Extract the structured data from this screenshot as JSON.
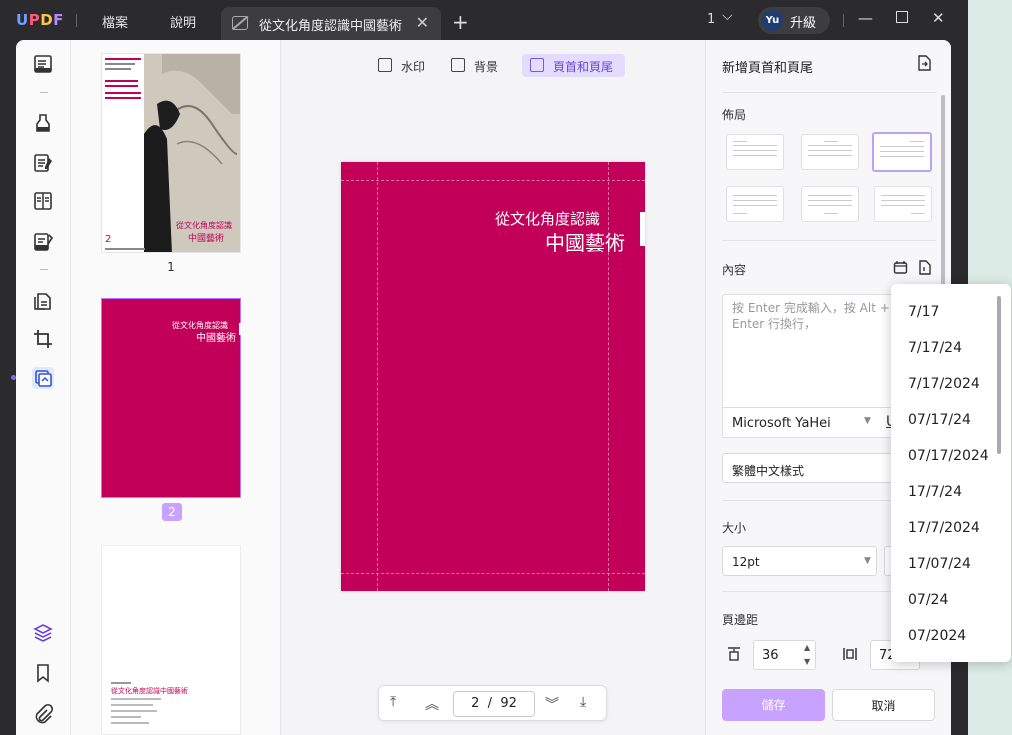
{
  "titlebar": {
    "logo": {
      "u": "U",
      "p": "P",
      "d": "D",
      "f": "F"
    },
    "menu": [
      "檔案",
      "說明"
    ],
    "tab_title": "從文化角度認識中國藝術",
    "page_indicator": "1",
    "user_initials": "Yu",
    "upgrade": "升級"
  },
  "thumbnails": {
    "labels": [
      "1",
      "2"
    ],
    "thumb1": {
      "page_number": "2",
      "title_lines": [
        "從文化角度認識",
        "中國藝術"
      ]
    },
    "thumb2": {
      "title_lines": [
        "從文化角度認識",
        "中國藝術"
      ]
    },
    "thumb3": {
      "title": "從文化角度認識中國藝術"
    }
  },
  "toolbar": {
    "watermark": "水印",
    "background": "背景",
    "header_footer": "頁首和頁尾"
  },
  "page": {
    "title_line1": "從文化角度認識",
    "title_line2": "中國藝術",
    "background_color": "#c2005a"
  },
  "pager": {
    "current": "2",
    "separator": "/",
    "total": "92"
  },
  "panel": {
    "title": "新增頁首和頁尾",
    "layout_label": "佈局",
    "content_label": "內容",
    "content_placeholder": "按 Enter 完成輸入，按 Alt + Enter 行換行，",
    "font": "Microsoft YaHei",
    "number_style": "繁體中文樣式",
    "size_label": "大小",
    "size_value": "12pt",
    "margin_label": "頁邊距",
    "margin_top": "36",
    "margin_side": "72",
    "save": "儲存",
    "cancel": "取消"
  },
  "date_formats": [
    "7/17",
    "7/17/24",
    "7/17/2024",
    "07/17/24",
    "07/17/2024",
    "17/7/24",
    "17/7/2024",
    "17/07/24",
    "07/24",
    "07/2024"
  ],
  "colors": {
    "accent": "#c7a2ff",
    "active_tab": "#e3dcff",
    "page": "#c2005a"
  }
}
